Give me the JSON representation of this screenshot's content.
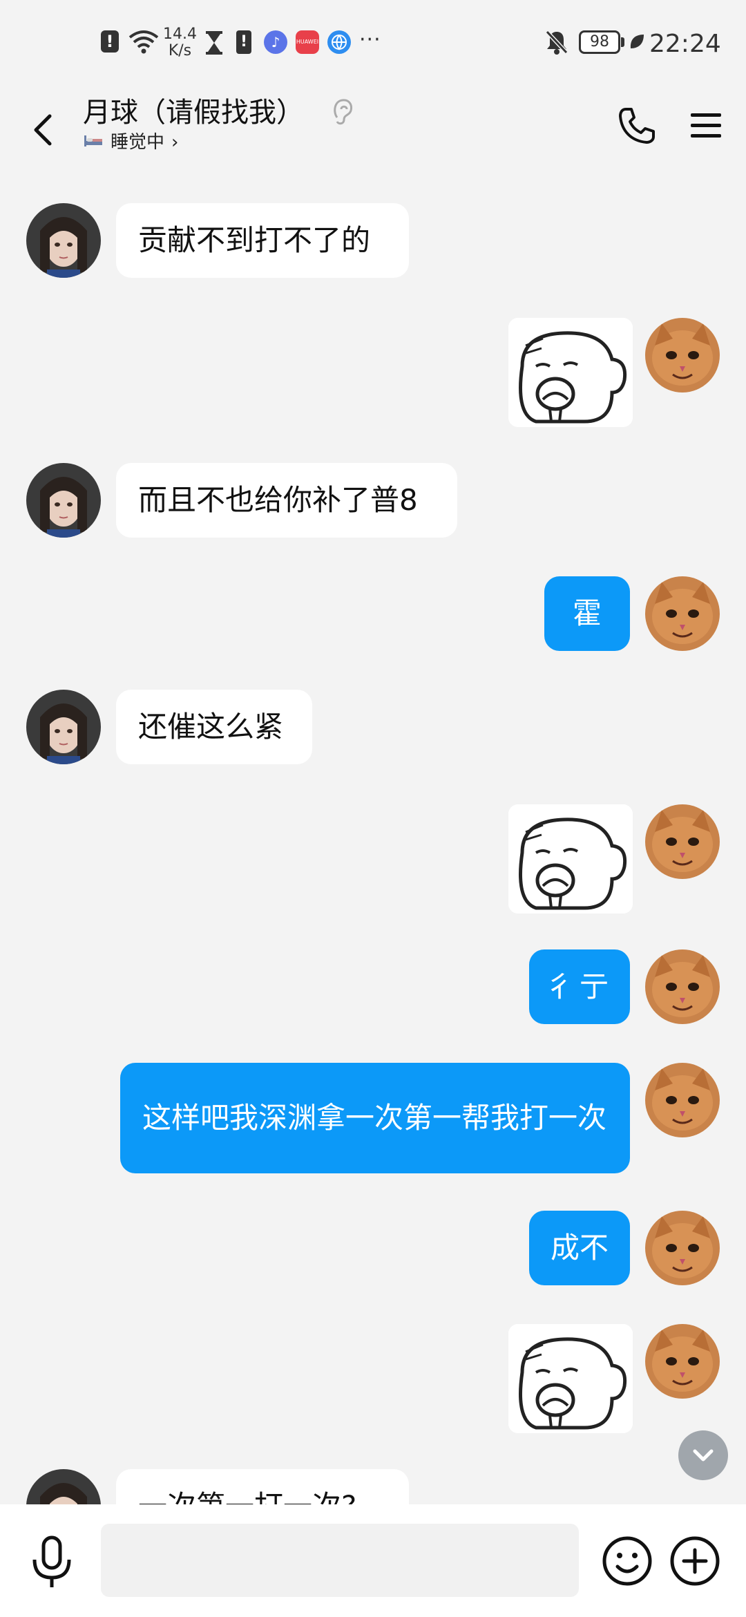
{
  "status_bar": {
    "alert": "!",
    "net_speed_value": "14.4",
    "net_speed_unit": "K/s",
    "battery_alert": "!",
    "huawei_label": "HUAWEI",
    "more": "···",
    "battery_level": "98",
    "time": "22:24"
  },
  "header": {
    "title": "月球（请假找我）",
    "status_text": "睡觉中",
    "status_chevron": "›"
  },
  "messages": [
    {
      "side": "in",
      "type": "text",
      "text": "贡献不到打不了的"
    },
    {
      "side": "out",
      "type": "sticker",
      "sticker": "bear-eating-sticker"
    },
    {
      "side": "in",
      "type": "text",
      "text": "而且不也给你补了普8"
    },
    {
      "side": "out",
      "type": "text",
      "text": "霍"
    },
    {
      "side": "in",
      "type": "text",
      "text": "还催这么紧"
    },
    {
      "side": "out",
      "type": "sticker",
      "sticker": "bear-eating-sticker"
    },
    {
      "side": "out",
      "type": "text",
      "text": "彳亍"
    },
    {
      "side": "out",
      "type": "text",
      "text": "这样吧我深渊拿一次第一帮我打一次"
    },
    {
      "side": "out",
      "type": "text",
      "text": "成不"
    },
    {
      "side": "out",
      "type": "sticker",
      "sticker": "bear-eating-sticker"
    },
    {
      "side": "in",
      "type": "text",
      "text": "一次第一打一次?"
    }
  ],
  "input": {
    "placeholder": ""
  },
  "colors": {
    "outgoing_bubble": "#0c99f8",
    "incoming_bubble": "#ffffff",
    "background": "#f3f3f3"
  }
}
